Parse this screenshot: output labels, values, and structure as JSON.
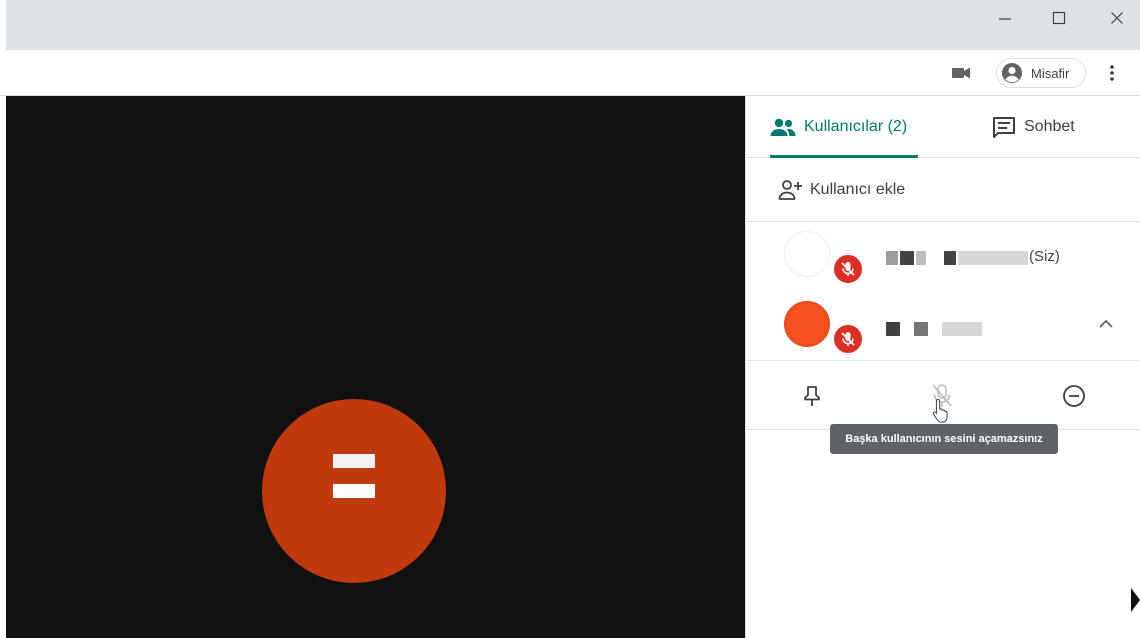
{
  "window": {
    "controls": [
      "minimize-icon",
      "maximize-icon",
      "close-icon"
    ]
  },
  "toolbar": {
    "profile_label": "Misafir",
    "icons": [
      "camera-in-use-icon",
      "account-circle-icon",
      "more-vert-icon"
    ]
  },
  "panel": {
    "tabs": [
      {
        "label": "Kullanıcılar (2)",
        "icon": "people-icon",
        "active": true
      },
      {
        "label": "Sohbet",
        "icon": "chat-icon",
        "active": false
      }
    ],
    "add_user_label": "Kullanıcı ekle",
    "participants": [
      {
        "name_suffix": "(Siz)",
        "avatar_color": "#ffffff",
        "muted": true
      },
      {
        "name_suffix": "",
        "avatar_color": "#f4511e",
        "muted": true
      }
    ],
    "actions": [
      "pin-icon",
      "mic-off-icon",
      "remove-icon"
    ],
    "tooltip": "Başka kullanıcının sesini açamazsınız"
  },
  "colors": {
    "accent": "#00796b",
    "muted_badge": "#d93025",
    "video_bg": "#111111",
    "big_avatar": "#c1390f"
  }
}
